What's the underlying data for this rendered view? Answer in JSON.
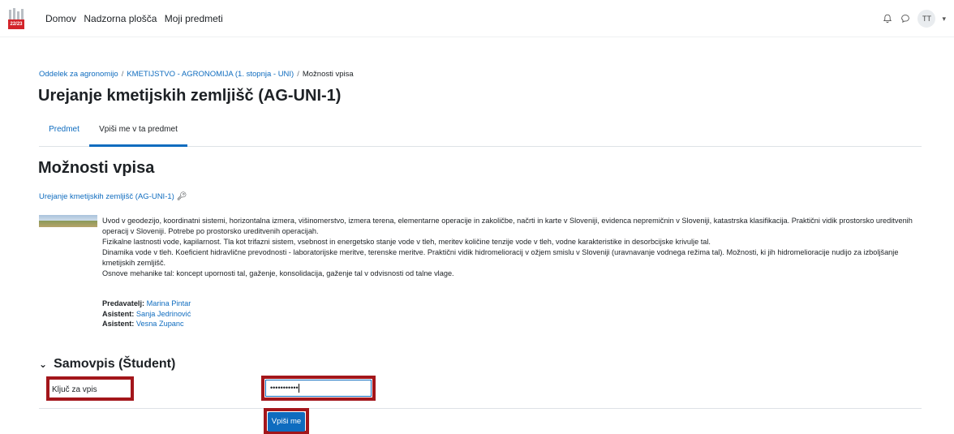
{
  "logo": {
    "badge_text": "22/23"
  },
  "nav": {
    "items": [
      "Domov",
      "Nadzorna plošča",
      "Moji predmeti"
    ],
    "avatar_initials": "TT"
  },
  "breadcrumb": {
    "items": [
      "Oddelek za agronomijo",
      "KMETIJSTVO - AGRONOMIJA (1. stopnja - UNI)",
      "Možnosti vpisa"
    ],
    "separator": "/"
  },
  "page_title": "Urejanje kmetijskih zemljišč (AG-UNI-1)",
  "tabs": [
    {
      "label": "Predmet",
      "active": false
    },
    {
      "label": "Vpiši me v ta predmet",
      "active": true
    }
  ],
  "section_title": "Možnosti vpisa",
  "course_link": "Urejanje kmetijskih zemljišč (AG-UNI-1)",
  "summary": [
    "Uvod v geodezijo, koordinatni sistemi, horizontalna izmera, višinomerstvo, izmera terena, elementarne operacije in zakoličbe, načrti in karte v Sloveniji, evidenca nepremičnin v Sloveniji, katastrska klasifikacija. Praktični vidik prostorsko ureditvenih operacij v Sloveniji. Potrebe po prostorsko ureditvenih operacijah.",
    "Fizikalne lastnosti vode, kapilarnost. Tla kot trifazni sistem, vsebnost in energetsko stanje vode v tleh, meritev količine tenzije vode v tleh, vodne karakteristike in desorbcijske krivulje tal.",
    "Dinamika vode v tleh. Koeficient hidravlične prevodnosti - laboratorijske meritve, terenske meritve. Praktični vidik hidromelioracij v ožjem smislu v Sloveniji (uravnavanje vodnega režima tal). Možnosti, ki jih hidromelioracije nudijo za izboljšanje kmetijskih zemljišč.",
    "Osnove mehanike tal: koncept upornosti tal, gaženje, konsolidacija, gaženje tal v odvisnosti od talne vlage."
  ],
  "teachers": [
    {
      "role": "Predavatelj:",
      "name": "Marina Pintar"
    },
    {
      "role": "Asistent:",
      "name": "Sanja Jedrinović"
    },
    {
      "role": "Asistent:",
      "name": "Vesna Zupanc"
    }
  ],
  "enrol": {
    "heading": "Samovpis (Študent)",
    "key_label": "Ključ za vpis",
    "key_value": "•••••••••••",
    "submit_label": "Vpiši me"
  },
  "colors": {
    "link": "#0f6cbf",
    "highlight": "#a3161b",
    "button": "#0f6cbf"
  }
}
